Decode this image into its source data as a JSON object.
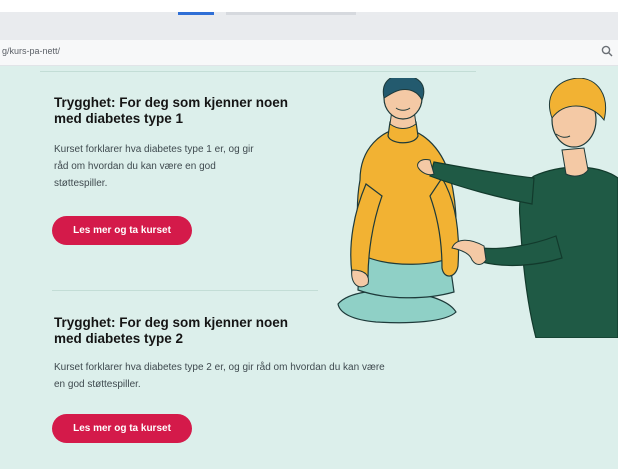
{
  "browser": {
    "url": "g/kurs-pa-nett/",
    "search_icon": "search-icon"
  },
  "cards": [
    {
      "title_line1": "Trygghet: For deg som kjenner noen",
      "title_line2": "med diabetes type 1",
      "text_lines": [
        "Kurset forklarer hva diabetes type 1 er, og gir",
        "råd om hvordan du kan være en god",
        "støttespiller."
      ],
      "button_label": "Les mer og ta kurset"
    },
    {
      "title_line1": "Trygghet: For deg som kjenner noen",
      "title_line2": "med diabetes type 2",
      "text_lines": [
        "Kurset forklarer hva diabetes type 2 er, og gir råd om hvordan du kan være",
        "en god støttespiller."
      ],
      "button_label": "Les mer og ta kurset"
    }
  ],
  "illustration": {
    "icon": "two-people-illustration",
    "colors": {
      "sweater": "#f2b233",
      "jacket": "#1f5a45",
      "skin": "#f4c9a5",
      "hair_left": "#235a6e",
      "hair_right": "#f2b233",
      "trousers": "#8fd0c6"
    }
  },
  "colors": {
    "background": "#dcefeb",
    "button": "#d41a4a",
    "divider": "#c3ddd6"
  }
}
